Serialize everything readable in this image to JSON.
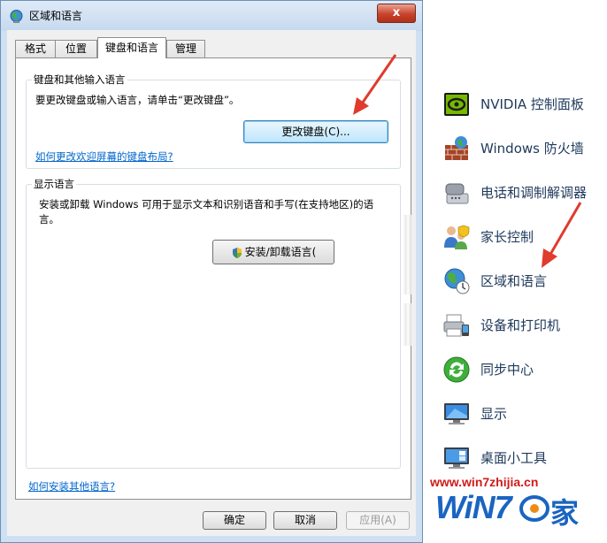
{
  "dialog": {
    "title": "区域和语言",
    "close_label": "x",
    "tabs": [
      {
        "label": "格式"
      },
      {
        "label": "位置"
      },
      {
        "label": "键盘和语言"
      },
      {
        "label": "管理"
      }
    ],
    "active_tab": "键盘和语言",
    "keyboard_group": {
      "title": "键盘和其他输入语言",
      "description": "要更改键盘或输入语言，请单击“更改键盘”。",
      "change_keyboard_button": "更改键盘(C)...",
      "welcome_layout_link": "如何更改欢迎屏幕的键盘布局?"
    },
    "display_group": {
      "title": "显示语言",
      "description": "安装或卸载 Windows 可用于显示文本和识别语音和手写(在支持地区)的语言。",
      "install_button": "安装/卸载语言("
    },
    "install_other_link": "如何安装其他语言?",
    "buttons": {
      "ok": "确定",
      "cancel": "取消",
      "apply": "应用(A)"
    }
  },
  "control_panel": {
    "items": [
      {
        "label": "NVIDIA 控制面板",
        "icon": "nvidia-icon"
      },
      {
        "label": "Windows 防火墙",
        "icon": "firewall-icon"
      },
      {
        "label": "电话和调制解调器",
        "icon": "phone-modem-icon"
      },
      {
        "label": "家长控制",
        "icon": "parental-control-icon"
      },
      {
        "label": "区域和语言",
        "icon": "region-language-icon"
      },
      {
        "label": "设备和打印机",
        "icon": "devices-printers-icon"
      },
      {
        "label": "同步中心",
        "icon": "sync-center-icon"
      },
      {
        "label": "显示",
        "icon": "display-icon"
      },
      {
        "label": "桌面小工具",
        "icon": "desktop-gadgets-icon"
      }
    ]
  },
  "watermark": {
    "url": "www.win7zhijia.cn",
    "logo_text": "WiN7",
    "logo_suffix": "家"
  },
  "colors": {
    "link": "#0066cc",
    "arrow": "#e03b2c",
    "close_button": "#c7432b",
    "window_frame": "#cfe0f3"
  }
}
